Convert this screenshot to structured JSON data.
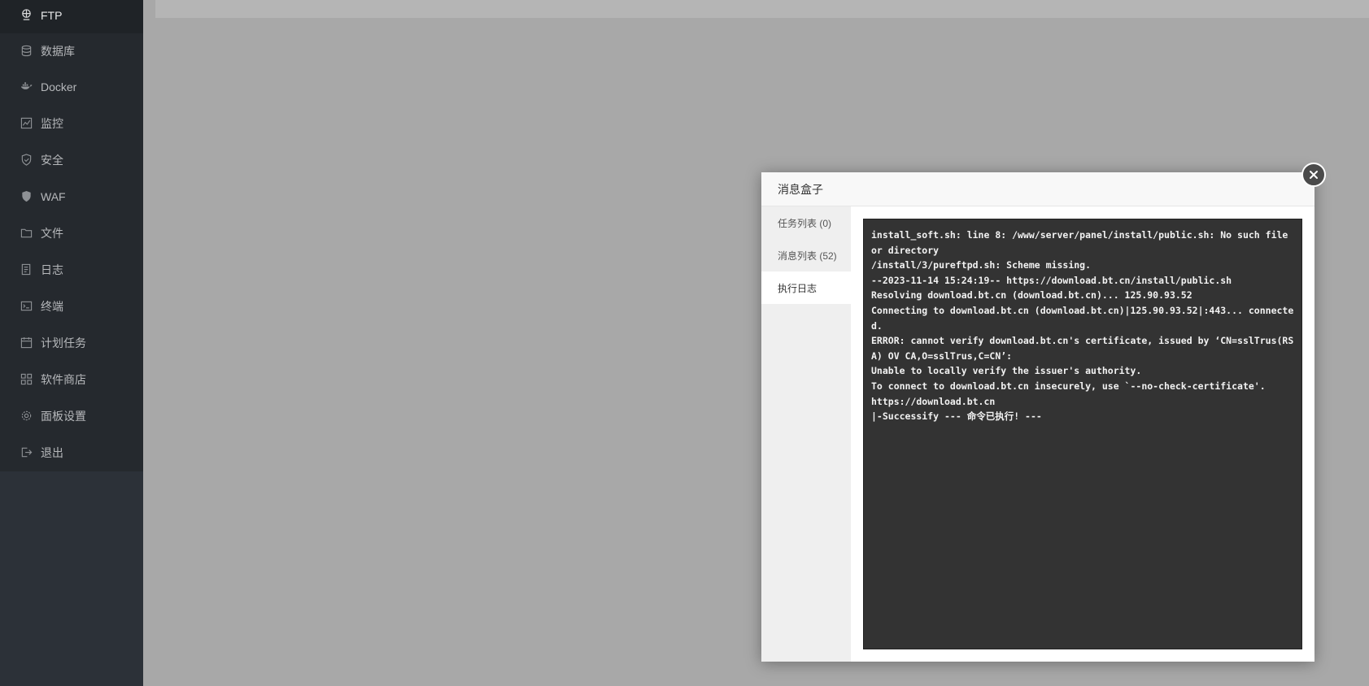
{
  "sidebar": {
    "items": [
      {
        "label": "FTP",
        "icon": "ftp-icon"
      },
      {
        "label": "数据库",
        "icon": "database-icon"
      },
      {
        "label": "Docker",
        "icon": "docker-icon"
      },
      {
        "label": "监控",
        "icon": "monitor-icon"
      },
      {
        "label": "安全",
        "icon": "shield-icon"
      },
      {
        "label": "WAF",
        "icon": "waf-shield-icon"
      },
      {
        "label": "文件",
        "icon": "folder-icon"
      },
      {
        "label": "日志",
        "icon": "log-icon"
      },
      {
        "label": "终端",
        "icon": "terminal-icon"
      },
      {
        "label": "计划任务",
        "icon": "calendar-icon"
      },
      {
        "label": "软件商店",
        "icon": "grid-icon"
      },
      {
        "label": "面板设置",
        "icon": "gear-icon"
      },
      {
        "label": "退出",
        "icon": "logout-icon"
      }
    ]
  },
  "dialog": {
    "title": "消息盒子",
    "tabs": [
      {
        "label": "任务列表 (0)"
      },
      {
        "label": "消息列表 (52)"
      },
      {
        "label": "执行日志"
      }
    ],
    "active_tab": "执行日志",
    "log_lines": [
      "install_soft.sh: line 8: /www/server/panel/install/public.sh: No such file or directory",
      "/install/3/pureftpd.sh: Scheme missing.",
      "--2023-11-14 15:24:19-- https://download.bt.cn/install/public.sh",
      "Resolving download.bt.cn (download.bt.cn)... 125.90.93.52",
      "Connecting to download.bt.cn (download.bt.cn)|125.90.93.52|:443... connected.",
      "ERROR: cannot verify download.bt.cn's certificate, issued by ‘CN=sslTrus(RSA) OV CA,O=sslTrus,C=CN’:",
      "Unable to locally verify the issuer's authority.",
      "To connect to download.bt.cn insecurely, use `--no-check-certificate'.",
      "https://download.bt.cn",
      "|-Successify --- 命令已执行! ---"
    ]
  }
}
